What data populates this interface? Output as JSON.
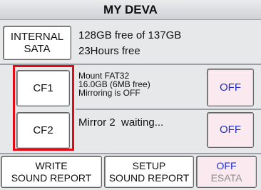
{
  "title": "MY DEVA",
  "internal": {
    "button_line1": "INTERNAL",
    "button_line2": "SATA",
    "free_space": "128GB free of 137GB",
    "time_free": "23Hours free"
  },
  "cf1": {
    "button_label": "CF1",
    "info_line1": "Mount FAT32",
    "info_line2": "16.0GB (6MB free)",
    "info_line3": "Mirroring is OFF",
    "toggle_label": "OFF"
  },
  "cf2": {
    "button_label": "CF2",
    "status": "Mirror 2  waiting...",
    "toggle_label": "OFF"
  },
  "bottom": {
    "write_line1": "WRITE",
    "write_line2": "SOUND REPORT",
    "setup_line1": "SETUP",
    "setup_line2": "SOUND REPORT",
    "esata_line1": "OFF",
    "esata_line2": "ESATA"
  },
  "colors": {
    "highlight_outline": "#e10b15",
    "off_text": "#1f2bcc",
    "toggle_background": "#fbe9f0"
  }
}
